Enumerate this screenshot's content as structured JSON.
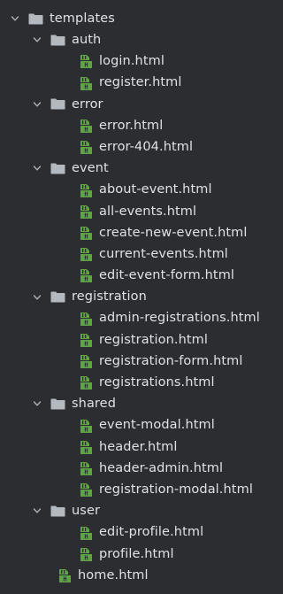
{
  "tree": {
    "root": {
      "name": "templates",
      "icon": "folder-icon",
      "expanded": true,
      "folders": [
        {
          "name": "auth",
          "expanded": true,
          "files": [
            "login.html",
            "register.html"
          ]
        },
        {
          "name": "error",
          "expanded": true,
          "files": [
            "error.html",
            "error-404.html"
          ]
        },
        {
          "name": "event",
          "expanded": true,
          "files": [
            "about-event.html",
            "all-events.html",
            "create-new-event.html",
            "current-events.html",
            "edit-event-form.html"
          ]
        },
        {
          "name": "registration",
          "expanded": true,
          "files": [
            "admin-registrations.html",
            "registration.html",
            "registration-form.html",
            "registrations.html"
          ]
        },
        {
          "name": "shared",
          "expanded": true,
          "files": [
            "event-modal.html",
            "header.html",
            "header-admin.html",
            "registration-modal.html"
          ]
        },
        {
          "name": "user",
          "expanded": true,
          "files": [
            "edit-profile.html",
            "profile.html"
          ]
        }
      ],
      "files": [
        "home.html"
      ]
    }
  },
  "colors": {
    "background": "#2b2d30",
    "text": "#dfe1e5",
    "folder": "#b4b8bf",
    "html_icon_green": "#5fa347",
    "html_icon_dark": "#3d3f43"
  }
}
